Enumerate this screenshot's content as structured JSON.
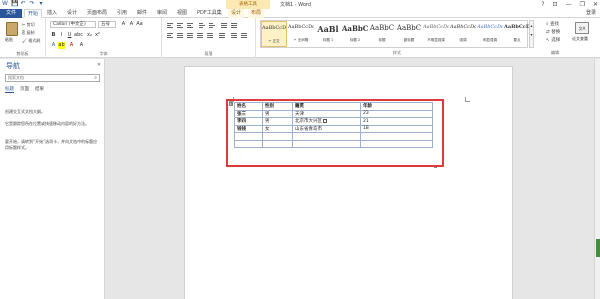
{
  "window": {
    "title": "文档1 - Word",
    "context_label": "表格工具",
    "controls": [
      "?",
      "⊡",
      "—",
      "❐",
      "✕"
    ]
  },
  "qat": [
    "W",
    "💾",
    "↶",
    "↷",
    "▾"
  ],
  "tabs": [
    {
      "label": "文件"
    },
    {
      "label": "开始"
    },
    {
      "label": "插入"
    },
    {
      "label": "设计"
    },
    {
      "label": "页面布局"
    },
    {
      "label": "引用"
    },
    {
      "label": "邮件"
    },
    {
      "label": "审阅"
    },
    {
      "label": "视图"
    },
    {
      "label": "PDF工具集"
    },
    {
      "label": "设计"
    },
    {
      "label": "布局"
    }
  ],
  "signin": "登录",
  "ribbon": {
    "clipboard": {
      "paste": "粘贴",
      "cut": "✂ 剪切",
      "copy": "⎘ 复制",
      "painter": "🖌 格式刷",
      "label": "剪贴板"
    },
    "font": {
      "name": "Calibri (中文正)",
      "size": "五号",
      "label": "字体"
    },
    "paragraph": {
      "label": "段落"
    },
    "styles": {
      "label": "样式",
      "items": [
        {
          "sample": "AaBbCcDd",
          "name": "↵ 正文"
        },
        {
          "sample": "AaBbCcDd",
          "name": "↵ 无间隔"
        },
        {
          "sample": "AaBl",
          "name": "标题 1"
        },
        {
          "sample": "AaBbC",
          "name": "标题 2"
        },
        {
          "sample": "AaBbC",
          "name": "标题"
        },
        {
          "sample": "AaBbC",
          "name": "副标题"
        },
        {
          "sample": "AaBbCcDd",
          "name": "不明显强调"
        },
        {
          "sample": "AaBbCcDd",
          "name": "强调"
        },
        {
          "sample": "AaBbCcDd",
          "name": "明显强调"
        },
        {
          "sample": "AaBbCcDd",
          "name": "要点"
        }
      ]
    },
    "editing": {
      "find": "查找",
      "replace": "替换",
      "select": "选择",
      "label": "编辑"
    },
    "lang": {
      "icon": "文A",
      "label": "论文查重"
    }
  },
  "nav": {
    "title": "导航",
    "close": "✕",
    "search_placeholder": "搜索文档",
    "tabs": [
      "标题",
      "页面",
      "结果"
    ],
    "messages": [
      "创建交互式文档大纲。",
      "它是跟踪您所在位置或快速移动内容的好方法。",
      "要开始，请转到“开始”选项卡，并向文档中的标题应用标题样式。"
    ]
  },
  "table": {
    "headers": [
      "姓名",
      "性别",
      "籍贯",
      "年龄"
    ],
    "rows": [
      [
        "张三",
        "男",
        "天津",
        "23"
      ],
      [
        "李四",
        "男",
        "北京市大兴区",
        "21"
      ],
      [
        "钱钱",
        "女",
        "山东省青岛市",
        "18"
      ],
      [
        "",
        "",
        "",
        ""
      ],
      [
        "",
        "",
        "",
        ""
      ]
    ]
  },
  "colors": {
    "accent": "#2b579a",
    "highlight": "#e03b3b"
  }
}
